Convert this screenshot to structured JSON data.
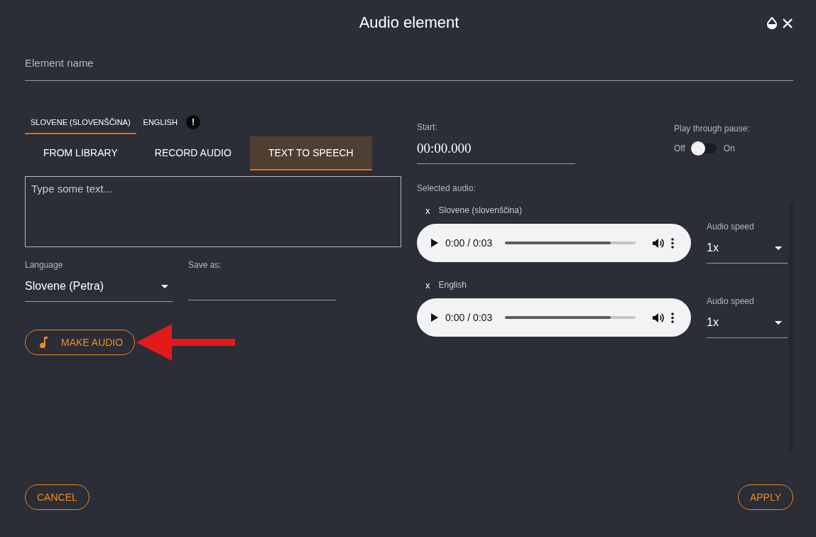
{
  "dialog": {
    "title": "Audio element"
  },
  "element_name": {
    "placeholder": "Element name"
  },
  "language_tabs": [
    {
      "label": "SLOVENE (SLOVENŠČINA)",
      "selected": true,
      "warning": false
    },
    {
      "label": "ENGLISH",
      "selected": false,
      "warning": true,
      "badge": "!"
    }
  ],
  "source_tabs": [
    {
      "label": "FROM LIBRARY",
      "selected": false
    },
    {
      "label": "RECORD AUDIO",
      "selected": false
    },
    {
      "label": "TEXT TO SPEECH",
      "selected": true
    }
  ],
  "text_input": {
    "placeholder": "Type some text..."
  },
  "language_select": {
    "label": "Language",
    "value": "Slovene (Petra)"
  },
  "save_as": {
    "label": "Save as:"
  },
  "make_audio_button": "MAKE AUDIO",
  "start": {
    "label": "Start:",
    "value": "00:00.000"
  },
  "play_through_pause": {
    "label": "Play through pause:",
    "off_label": "Off",
    "on_label": "On",
    "on": false
  },
  "selected_audio_label": "Selected audio:",
  "selected_audio": [
    {
      "remove": "x",
      "name": "Slovene (slovenščina)",
      "time": "0:00 / 0:03",
      "level": 0.81,
      "speed_label": "Audio speed",
      "speed": "1x"
    },
    {
      "remove": "x",
      "name": "English",
      "time": "0:00 / 0:03",
      "level": 0.81,
      "speed_label": "Audio speed",
      "speed": "1x"
    }
  ],
  "cancel_button": "CANCEL",
  "apply_button": "APPLY"
}
